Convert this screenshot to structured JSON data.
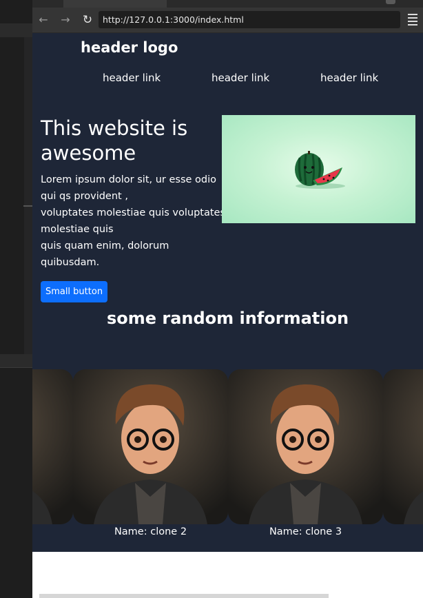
{
  "browser": {
    "url": "http://127.0.0.1:3000/index.html",
    "back_icon": "arrow-left-icon",
    "forward_icon": "arrow-right-icon",
    "reload_icon": "reload-icon",
    "menu_icon": "hamburger-menu-icon"
  },
  "header": {
    "logo": "header logo",
    "links": [
      "header link",
      "header link",
      "header link"
    ]
  },
  "hero": {
    "title": "This website is awesome",
    "paragraph_lines": [
      "Lorem ipsum dolor sit, ur esse odio",
      "qui qs provident ,",
      "voluptates molestiae quis voluptates",
      "molestiae quis",
      "quis quam enim, dolorum",
      "quibusdam."
    ],
    "button": "Small button"
  },
  "section": {
    "title": "some random information"
  },
  "cards": [
    {
      "caption": ""
    },
    {
      "caption": "Name: clone 2"
    },
    {
      "caption": "Name: clone 3"
    },
    {
      "caption": ""
    }
  ],
  "colors": {
    "page_bg": "#1e2637",
    "button": "#0d6efd",
    "text": "#ffffff",
    "browser_toolbar": "#353535"
  }
}
